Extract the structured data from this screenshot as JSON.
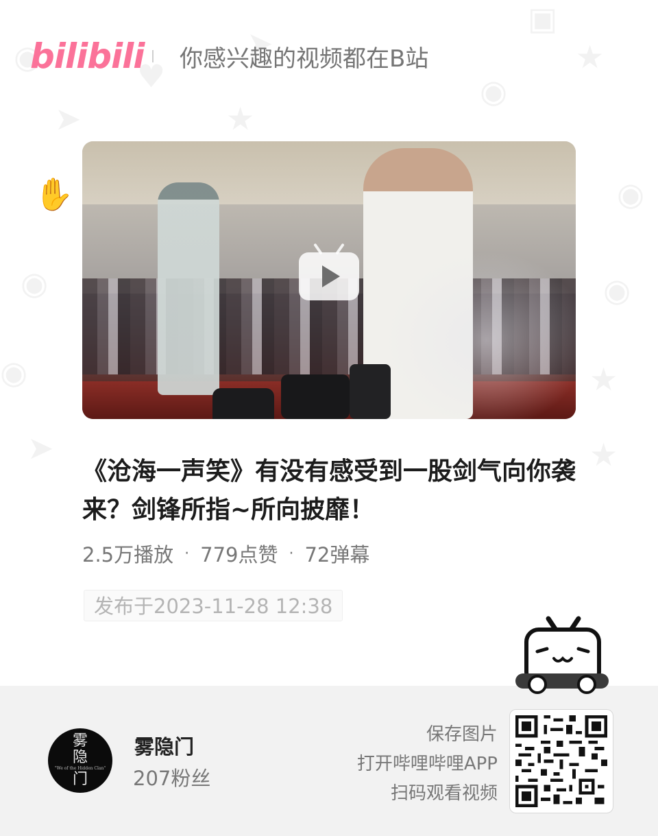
{
  "header": {
    "logo_text": "bilibili",
    "slogan": "你感兴趣的视频都在B站"
  },
  "video": {
    "title": "《沧海一声笑》有没有感受到一股剑气向你袭来？剑锋所指~所向披靡！",
    "views": "2.5万播放",
    "likes": "779点赞",
    "danmaku": "72弹幕",
    "separator": "·",
    "published": "发布于2023-11-28 12:38"
  },
  "uploader": {
    "name": "雾隐门",
    "fans": "207粉丝",
    "avatar_text_1": "雾",
    "avatar_text_2": "隐",
    "avatar_text_3": "门",
    "avatar_small": "\"We of the Hidden Clan\""
  },
  "cta": {
    "line1": "保存图片",
    "line2": "打开哔哩哔哩APP",
    "line3": "扫码观看视频"
  },
  "colors": {
    "brand": "#fb7299",
    "text_dark": "#1c1c1c",
    "text_muted": "#777777",
    "footer_bg": "#f2f2f2"
  },
  "icons": {
    "play": "play-icon",
    "mascot": "bilibili-tv-mascot-icon",
    "qr": "qr-code-icon"
  }
}
